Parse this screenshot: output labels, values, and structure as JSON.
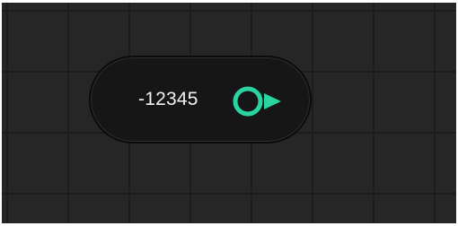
{
  "node": {
    "value": "-12345"
  },
  "output_port": {
    "icon": "output-port-icon",
    "color": "#2ad4a0"
  },
  "colors": {
    "canvas": "#262626",
    "grid_line": "#1c1c1c",
    "node_fill": "#161616"
  }
}
